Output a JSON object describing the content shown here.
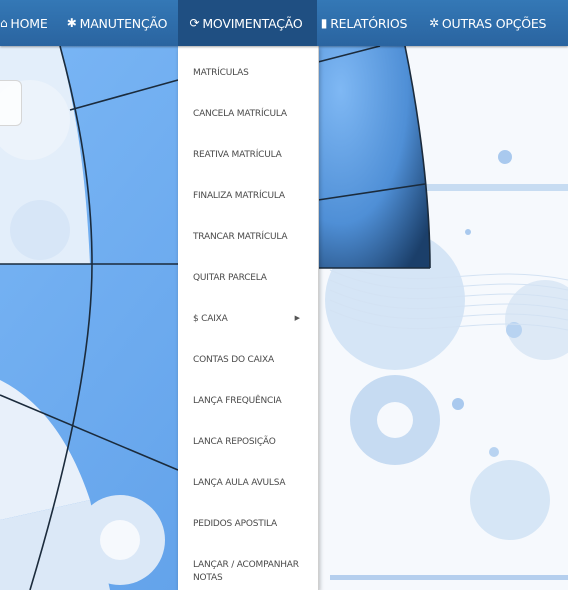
{
  "nav": {
    "home": "HOME",
    "manutencao": "MANUTENÇÃO",
    "movimentacao": "MOVIMENTAÇÃO",
    "relatorios": "RELATÓRIOS",
    "outras": "OUTRAS OPÇÕES"
  },
  "icons": {
    "home": "home-icon",
    "manutencao": "gear-icon",
    "movimentacao": "refresh-icon",
    "relatorios": "document-icon",
    "outras": "gears-icon"
  },
  "dropdown": {
    "items": [
      "MATRÍCULAS",
      "CANCELA MATRÍCULA",
      "REATIVA MATRÍCULA",
      "FINALIZA MATRÍCULA",
      "TRANCAR MATRÍCULA",
      "QUITAR PARCELA",
      "$ CAIXA",
      "CONTAS DO CAIXA",
      "LANÇA FREQUÊNCIA",
      "LANCA REPOSIÇÃO",
      "LANÇA AULA AVULSA",
      "PEDIDOS APOSTILA",
      "LANÇAR / ACOMPANHAR NOTAS"
    ],
    "submenu_arrow": "▶"
  },
  "colors": {
    "navbar": "#2f6ea8",
    "nav_active": "#1f4f82",
    "bg_blue": "#6aaaf0",
    "bg_light": "#c9dcf2"
  }
}
